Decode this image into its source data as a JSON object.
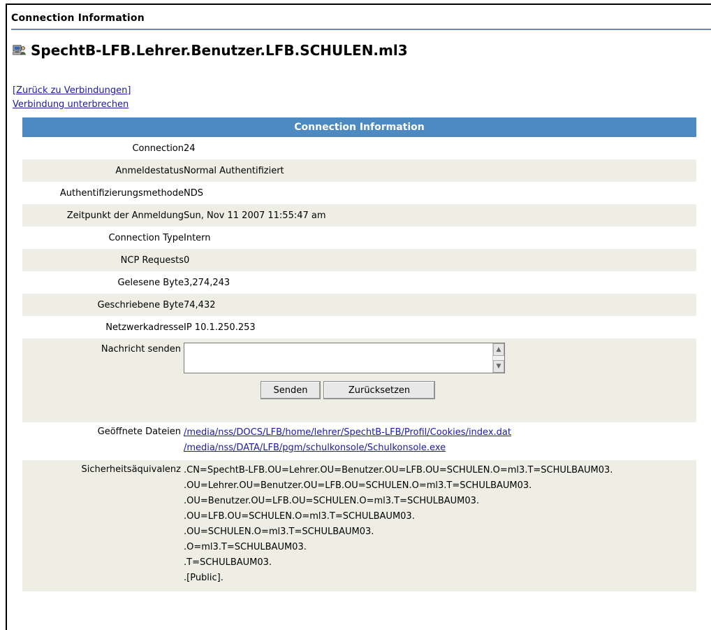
{
  "page": {
    "header": "Connection Information",
    "title": "SpechtB-LFB.Lehrer.Benutzer.LFB.SCHULEN.ml3",
    "title_icon": "computer-user-icon"
  },
  "links": {
    "back": "[Zurück zu Verbindungen]",
    "disconnect": "Verbindung unterbrechen"
  },
  "table": {
    "banner": "Connection Information",
    "rows": [
      {
        "label": "Connection",
        "value": "24"
      },
      {
        "label": "Anmeldestatus",
        "value": "Normal Authentifiziert"
      },
      {
        "label": "Authentifizierungsmethode",
        "value": "NDS"
      },
      {
        "label": "Zeitpunkt der Anmeldung",
        "value": "Sun, Nov 11 2007 11:55:47 am"
      },
      {
        "label": "Connection Type",
        "value": "Intern"
      },
      {
        "label": "NCP Requests",
        "value": "0"
      },
      {
        "label": "Gelesene Byte",
        "value": "3,274,243"
      },
      {
        "label": "Geschriebene Byte",
        "value": "74,432"
      },
      {
        "label": "Netzwerkadresse",
        "value": "IP 10.1.250.253"
      }
    ],
    "message": {
      "label": "Nachricht senden",
      "value": "",
      "send_label": "Senden",
      "reset_label": "Zurücksetzen"
    },
    "files": {
      "label": "Geöffnete Dateien",
      "items": [
        "/media/nss/DOCS/LFB/home/lehrer/SpechtB-LFB/Profil/Cookies/index.dat",
        "/media/nss/DATA/LFB/pgm/schulkonsole/Schulkonsole.exe"
      ]
    },
    "security": {
      "label": "Sicherheitsäquivalenz",
      "items": [
        ".CN=SpechtB-LFB.OU=Lehrer.OU=Benutzer.OU=LFB.OU=SCHULEN.O=ml3.T=SCHULBAUM03.",
        ".OU=Lehrer.OU=Benutzer.OU=LFB.OU=SCHULEN.O=ml3.T=SCHULBAUM03.",
        ".OU=Benutzer.OU=LFB.OU=SCHULEN.O=ml3.T=SCHULBAUM03.",
        ".OU=LFB.OU=SCHULEN.O=ml3.T=SCHULBAUM03.",
        ".OU=SCHULEN.O=ml3.T=SCHULBAUM03.",
        ".O=ml3.T=SCHULBAUM03.",
        ".T=SCHULBAUM03.",
        ".[Public]."
      ]
    }
  },
  "colors": {
    "banner": "#4c8ac1",
    "row_shade": "#eeeee4",
    "link": "#1a1aa6",
    "rule": "#6d8aa8"
  }
}
